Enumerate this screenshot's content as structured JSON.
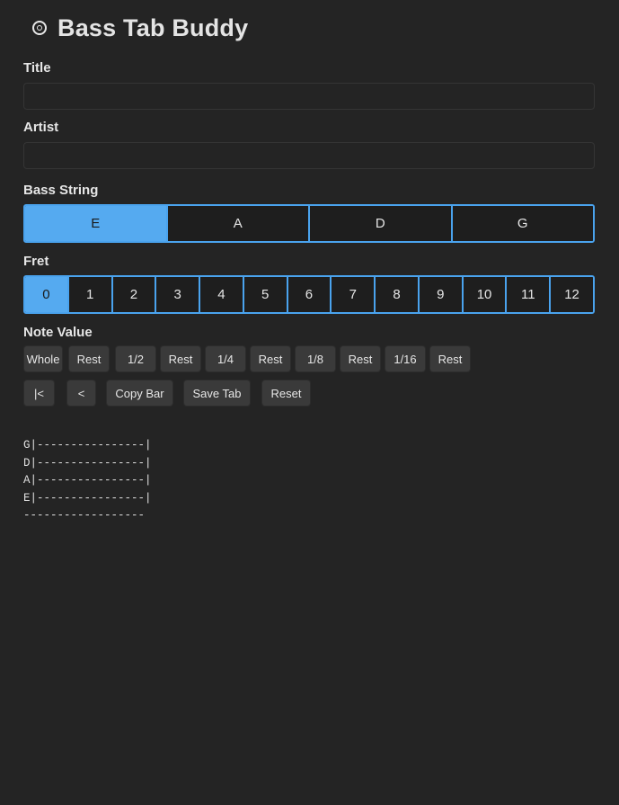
{
  "app": {
    "title": "Bass Tab Buddy",
    "logo_icon": "music-disc-icon"
  },
  "form": {
    "title_label": "Title",
    "title_value": "",
    "artist_label": "Artist",
    "artist_value": ""
  },
  "bass_string": {
    "label": "Bass String",
    "options": [
      "E",
      "A",
      "D",
      "G"
    ],
    "selected": "E"
  },
  "fret": {
    "label": "Fret",
    "options": [
      "0",
      "1",
      "2",
      "3",
      "4",
      "5",
      "6",
      "7",
      "8",
      "9",
      "10",
      "11",
      "12"
    ],
    "selected": "0"
  },
  "note_value": {
    "label": "Note Value",
    "buttons": [
      "Whole",
      "Rest",
      "1/2",
      "Rest",
      "1/4",
      "Rest",
      "1/8",
      "Rest",
      "1/16",
      "Rest"
    ]
  },
  "controls": {
    "first": "|<",
    "back": "<",
    "copy_bar": "Copy Bar",
    "save_tab": "Save Tab",
    "reset": "Reset"
  },
  "tab_lines": [
    "G|----------------|",
    "D|----------------|",
    "A|----------------|",
    "E|----------------|",
    "------------------"
  ],
  "colors": {
    "background": "#242424",
    "accent": "#55aaf0",
    "border_accent": "#4aa3ee",
    "button": "#3a3a3a"
  }
}
